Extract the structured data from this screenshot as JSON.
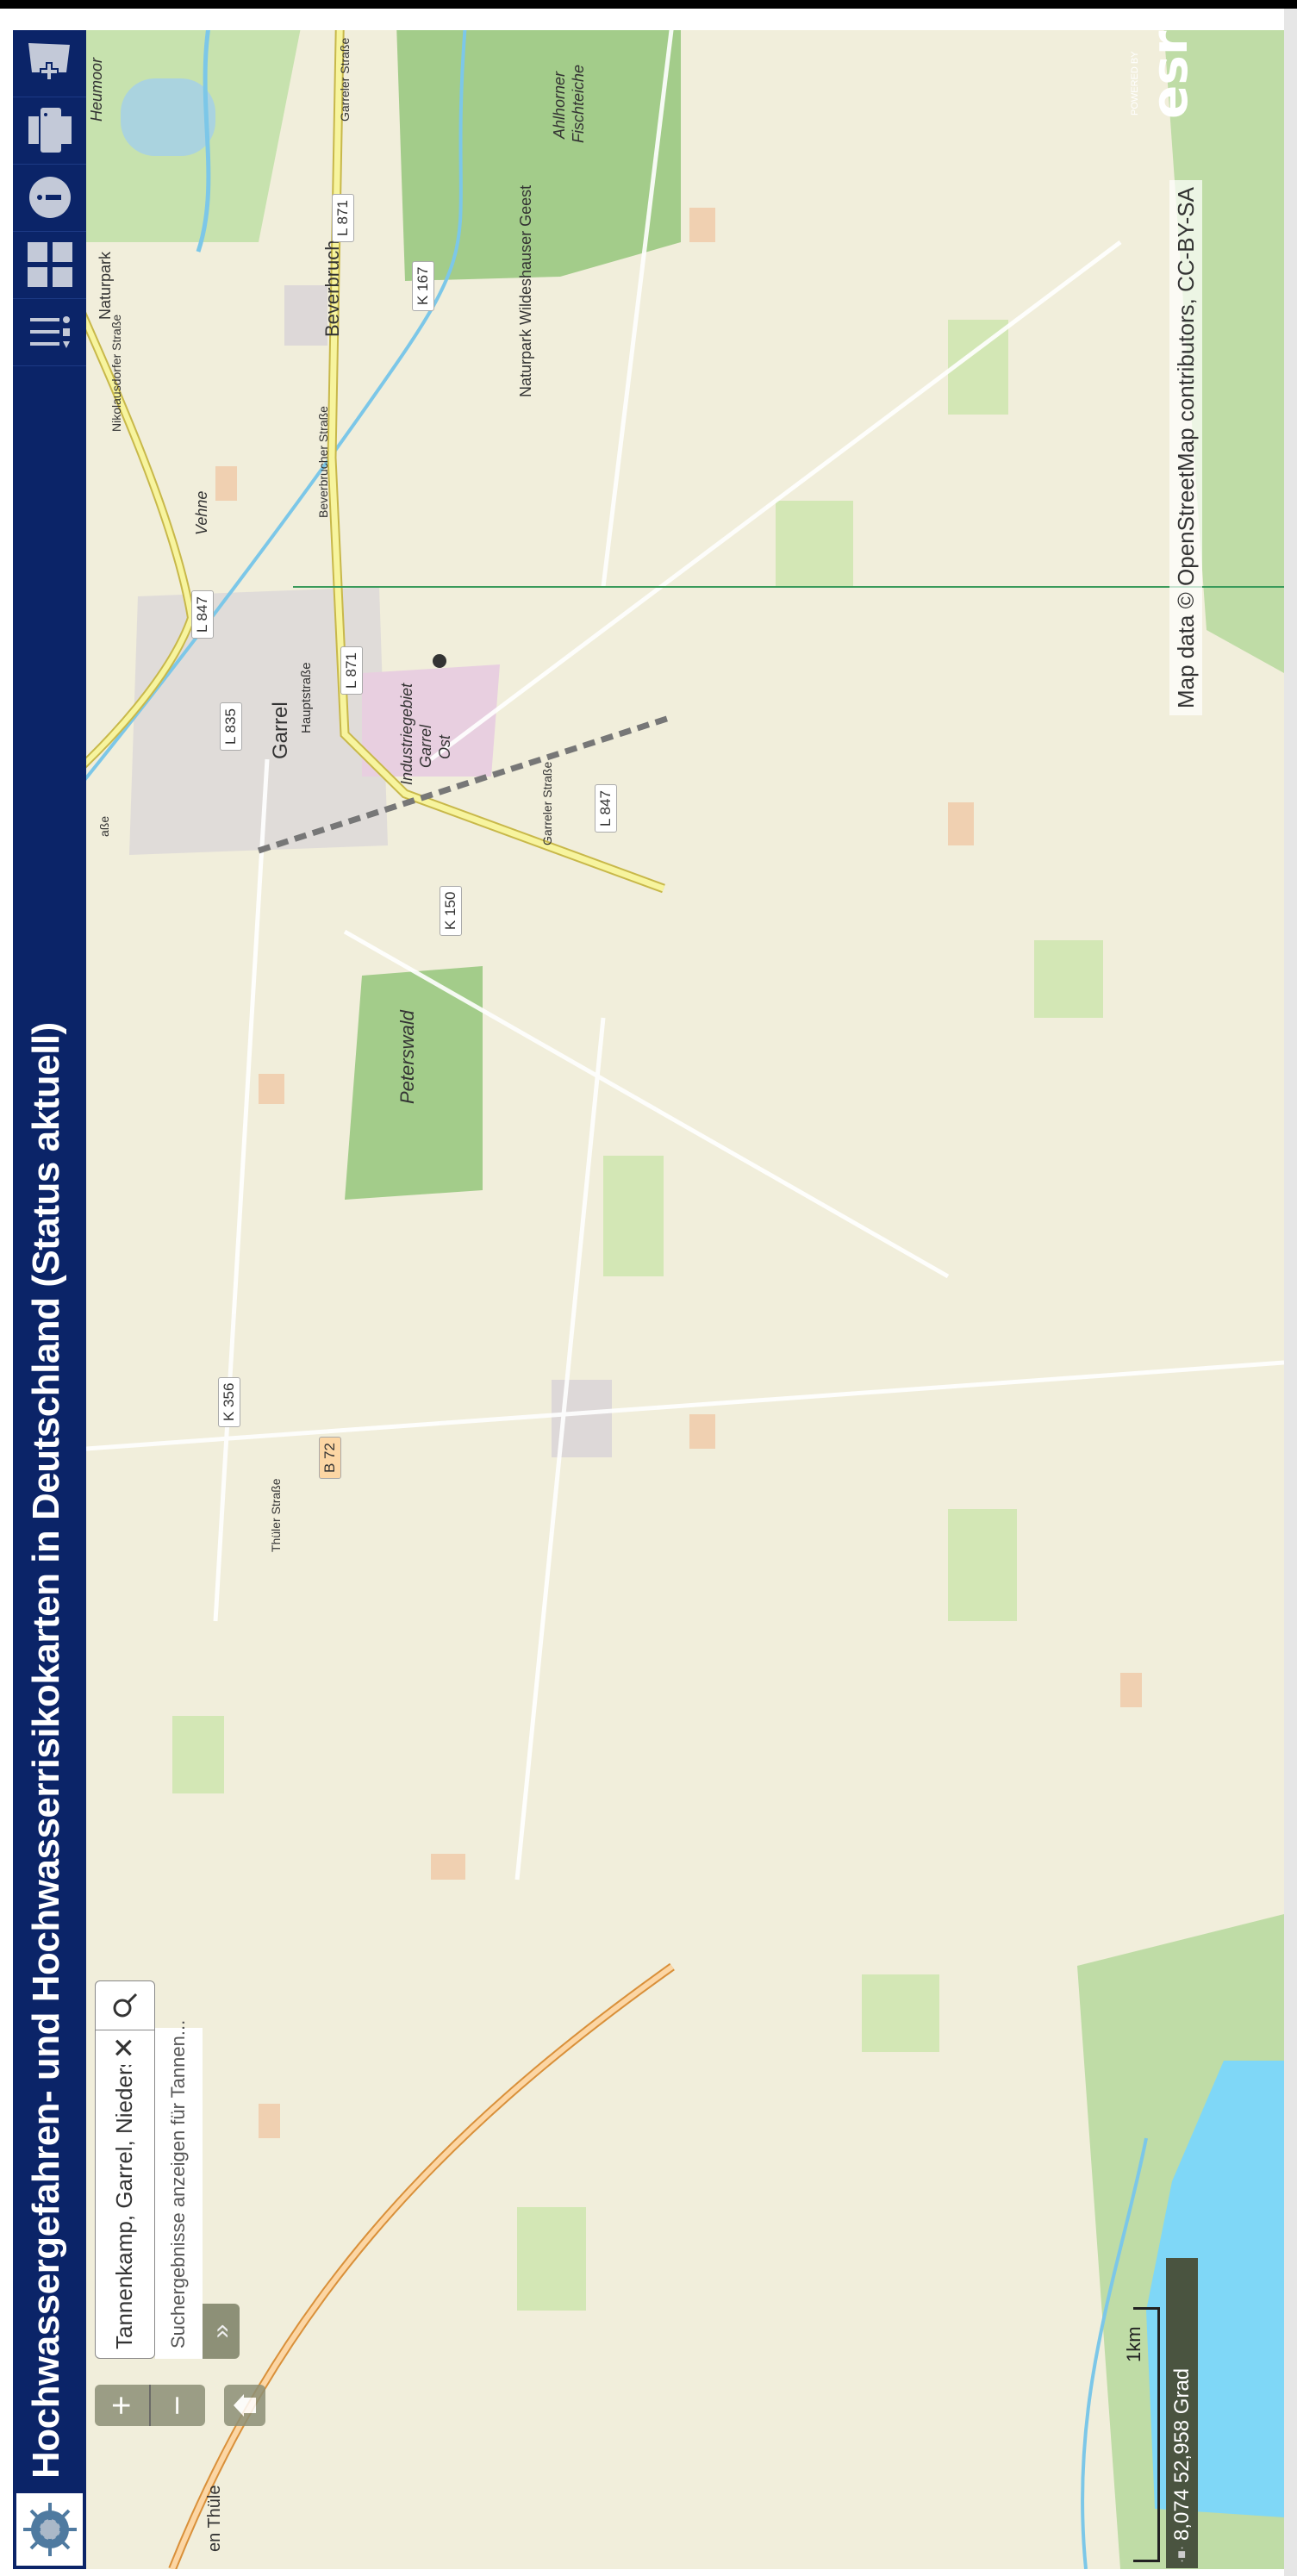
{
  "header": {
    "title": "Hochwassergefahren- und Hochwasserrisikokarten in Deutschland (Status aktuell)",
    "tools": [
      {
        "name": "legend-icon"
      },
      {
        "name": "basemap-gallery-icon"
      },
      {
        "name": "info-icon"
      },
      {
        "name": "print-icon"
      },
      {
        "name": "add-data-icon"
      }
    ]
  },
  "search": {
    "value": "Tannenkamp, Garrel, Niedersach",
    "suggestion": "Suchergebnisse anzeigen für Tannen...",
    "clear": "✕",
    "expand": "»"
  },
  "zoom": {
    "in": "+",
    "out": "−"
  },
  "map": {
    "labels": {
      "garrel": "Garrel",
      "beverbruch": "Beverbruch",
      "industrie": "Industriegebiet",
      "garrel2": "Garrel",
      "ost": "Ost",
      "hauptstrasse": "Hauptstraße",
      "peterswald": "Peterswald",
      "vehne": "Vehne",
      "heumoor": "Heumoor",
      "naturpark": "Naturpark",
      "naturpark_full": "Naturpark Wildeshauser Geest",
      "ahlhorner": "Ahlhorner",
      "fischteiche": "Fischteiche",
      "beverbrucher": "Beverbrucher Straße",
      "garreler1": "Garreler Straße",
      "garreler2": "Garreler Straße",
      "nikolausdorfer": "Nikolausdorfer Straße",
      "thuler": "Thüler Straße",
      "thule": "en Thüle",
      "strasse_w": "aße"
    },
    "shields": {
      "l871a": "L 871",
      "l871b": "L 871",
      "l847a": "L 847",
      "l847b": "L 847",
      "l835": "L 835",
      "k167": "K 167",
      "k150": "K 150",
      "k356": "K 356",
      "b72": "B 72"
    }
  },
  "footer": {
    "coordinates": "8,074 52,958 Grad",
    "scale": "1km",
    "attribution": "Map data © OpenStreetMap contributors, CC-BY-SA",
    "esri_powered": "POWERED BY",
    "esri": "esri"
  },
  "colors": {
    "header": "#0b2468",
    "map_bg": "#f1eedb",
    "forest": "#add19e",
    "water": "#aad3df"
  }
}
